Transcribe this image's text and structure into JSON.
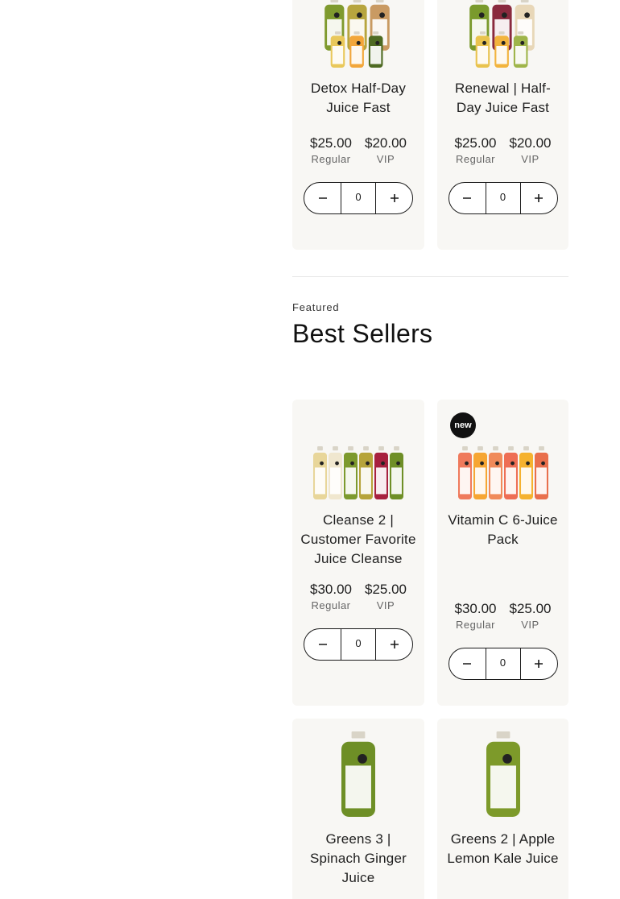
{
  "top_products": [
    {
      "title": "Detox Half-Day Juice Fast",
      "regular_price": "$25.00",
      "regular_label": "Regular",
      "vip_price": "$20.00",
      "vip_label": "VIP",
      "quantity": "0",
      "bottle_colors": [
        "#7f9a2e",
        "#b7a53e",
        "#c99a62",
        "#e9c85a",
        "#f2a63a",
        "#4e6a22"
      ]
    },
    {
      "title": "Renewal | Half-Day Juice Fast",
      "regular_price": "$25.00",
      "regular_label": "Regular",
      "vip_price": "$20.00",
      "vip_label": "VIP",
      "quantity": "0",
      "bottle_colors": [
        "#7a9a2c",
        "#8a2a3e",
        "#e8d7b8",
        "#e9c34e",
        "#f2b43e",
        "#9fb54a"
      ]
    }
  ],
  "section": {
    "eyebrow": "Featured",
    "heading": "Best Sellers"
  },
  "best_sellers": [
    {
      "title": "Cleanse 2 | Customer Favorite Juice Cleanse",
      "badge": "",
      "regular_price": "$30.00",
      "regular_label": "Regular",
      "vip_price": "$25.00",
      "vip_label": "VIP",
      "quantity": "0",
      "bottle_colors": [
        "#e8d69a",
        "#f0e7cf",
        "#7d9a2e",
        "#b6a43a",
        "#a7213f",
        "#6f8f27"
      ]
    },
    {
      "title": "Vitamin C 6-Juice Pack",
      "badge": "new",
      "regular_price": "$30.00",
      "regular_label": "Regular",
      "vip_price": "$25.00",
      "vip_label": "VIP",
      "quantity": "0",
      "bottle_colors": [
        "#ef7a5c",
        "#f6a633",
        "#f08a5a",
        "#ee6e55",
        "#f5b22f",
        "#e96f4c"
      ]
    },
    {
      "title": "Greens 3 | Spinach Ginger Juice",
      "badge": "",
      "bottle_colors": [
        "#6e8f26"
      ]
    },
    {
      "title": "Greens 2 | Apple Lemon Kale Juice",
      "badge": "",
      "bottle_colors": [
        "#7d9a2a"
      ]
    }
  ],
  "icons": {
    "decrement": "minus-icon",
    "increment": "plus-icon"
  }
}
